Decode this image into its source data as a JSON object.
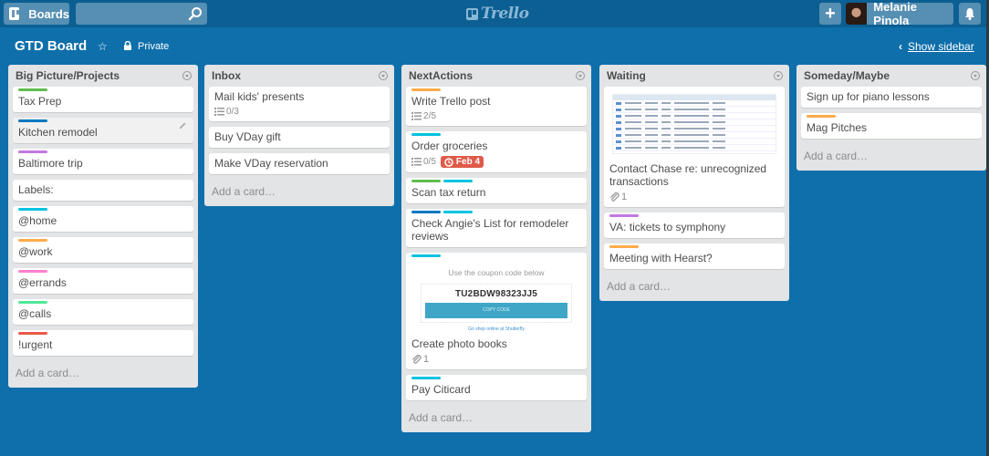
{
  "header": {
    "boards_label": "Boards",
    "search_placeholder": "",
    "logo_text": "Trello",
    "add_label": "+",
    "user_name": "Melanie Pinola"
  },
  "board": {
    "title": "GTD Board",
    "privacy": "Private",
    "show_sidebar": "Show sidebar"
  },
  "colors": {
    "green": "#61bd4f",
    "blue": "#0079bf",
    "purple": "#c377e0",
    "sky": "#00c2e0",
    "orange": "#ffab4a",
    "pink": "#ff80ce",
    "lime": "#51e898",
    "red": "#eb5a46",
    "due": "#e05a4a"
  },
  "add_card_label": "Add a card…",
  "lists": [
    {
      "title": "Big Picture/Projects",
      "cards": [
        {
          "title": "Tax Prep",
          "labels": [
            "#61bd4f"
          ]
        },
        {
          "title": "Kitchen remodel",
          "labels": [
            "#0079bf"
          ]
        },
        {
          "title": "Baltimore trip",
          "labels": [
            "#c377e0"
          ]
        },
        {
          "title": "Labels:",
          "labels": []
        },
        {
          "title": "@home",
          "labels": [
            "#00c2e0"
          ]
        },
        {
          "title": "@work",
          "labels": [
            "#ffab4a"
          ]
        },
        {
          "title": "@errands",
          "labels": [
            "#ff80ce"
          ]
        },
        {
          "title": "@calls",
          "labels": [
            "#51e898"
          ]
        },
        {
          "title": "!urgent",
          "labels": [
            "#eb5a46"
          ]
        }
      ]
    },
    {
      "title": "Inbox",
      "cards": [
        {
          "title": "Mail kids' presents",
          "labels": [],
          "checklist": "0/3"
        },
        {
          "title": "Buy VDay gift",
          "labels": []
        },
        {
          "title": "Make VDay reservation",
          "labels": []
        }
      ]
    },
    {
      "title": "NextActions",
      "cards": [
        {
          "title": "Write Trello post",
          "labels": [
            "#ffab4a"
          ],
          "checklist": "2/5"
        },
        {
          "title": "Order groceries",
          "labels": [
            "#00c2e0"
          ],
          "checklist": "0/5",
          "due": "Feb 4"
        },
        {
          "title": "Scan tax return",
          "labels": [
            "#61bd4f",
            "#00c2e0"
          ]
        },
        {
          "title": "Check Angie's List for remodeler reviews",
          "labels": [
            "#0079bf",
            "#00c2e0"
          ]
        },
        {
          "title": "Create photo books",
          "labels": [
            "#00c2e0"
          ],
          "attachments": "1",
          "coupon": {
            "heading": "Use the coupon code below",
            "code": "TU2BDW98323JJ5",
            "button": "COPY CODE",
            "footer": "Go shop online at Shutterfly"
          }
        },
        {
          "title": "Pay Citicard",
          "labels": [
            "#00c2e0"
          ]
        }
      ]
    },
    {
      "title": "Waiting",
      "cards": [
        {
          "title": "Contact Chase re: unrecognized transactions",
          "labels": [],
          "attachments": "1",
          "statement_cover": true
        },
        {
          "title": "VA: tickets to symphony",
          "labels": [
            "#c377e0"
          ]
        },
        {
          "title": "Meeting with Hearst?",
          "labels": [
            "#ffab4a"
          ]
        }
      ]
    },
    {
      "title": "Someday/Maybe",
      "cards": [
        {
          "title": "Sign up for piano lessons",
          "labels": []
        },
        {
          "title": "Mag Pitches",
          "labels": [
            "#ffab4a"
          ]
        }
      ]
    }
  ]
}
